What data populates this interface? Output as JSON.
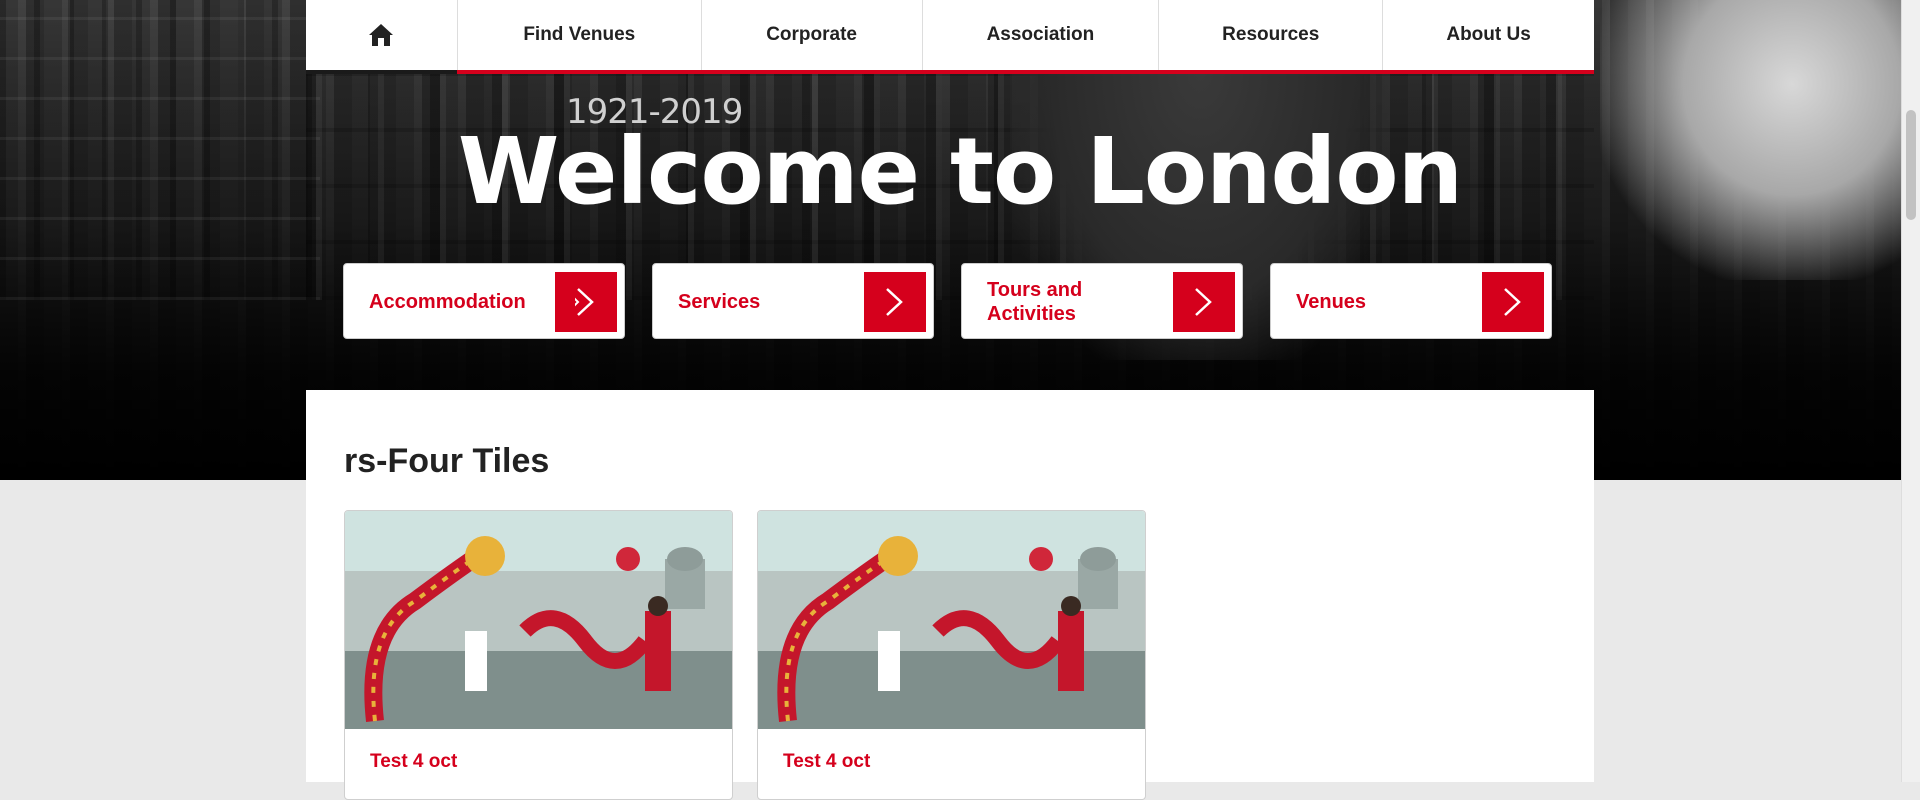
{
  "nav": {
    "home_icon": "home-icon",
    "items": [
      "Find Venues",
      "Corporate",
      "Association",
      "Resources",
      "About Us"
    ]
  },
  "hero": {
    "years": "1921-2019",
    "title": "Welcome to London"
  },
  "cta_buttons": [
    {
      "label": "Accommodation",
      "icon": "chevron-right-icon"
    },
    {
      "label": "Services",
      "icon": "chevron-right-icon"
    },
    {
      "label": "Tours and Activities",
      "icon": "chevron-right-icon"
    },
    {
      "label": "Venues",
      "icon": "chevron-right-icon"
    }
  ],
  "section": {
    "title": "rs-Four Tiles",
    "tiles": [
      {
        "caption": "Test 4 oct",
        "image": "dragon-dance-photo"
      },
      {
        "caption": "Test 4 oct",
        "image": "dragon-dance-photo"
      }
    ]
  },
  "colors": {
    "accent": "#d5001c",
    "page_bg": "#e9e9e9"
  }
}
